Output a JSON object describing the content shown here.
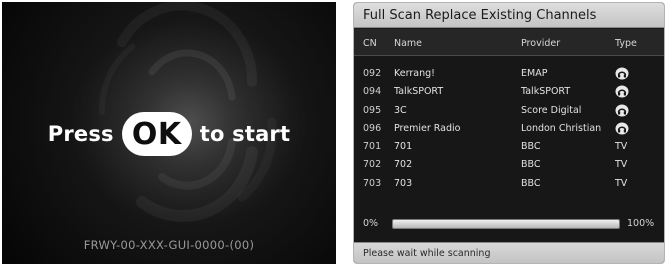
{
  "splash": {
    "press_label": "Press",
    "ok_label": "OK",
    "to_start_label": "to start",
    "firmware_code": "FRWY-00-XXX-GUI-0000-(00)"
  },
  "scan_panel": {
    "title": "Full Scan Replace Existing Channels",
    "columns": {
      "cn": "CN",
      "name": "Name",
      "provider": "Provider",
      "type": "Type"
    },
    "channels": [
      {
        "cn": "092",
        "name": "Kerrang!",
        "provider": "EMAP",
        "type": "",
        "type_icon": "radio-icon"
      },
      {
        "cn": "094",
        "name": "TalkSPORT",
        "provider": "TalkSPORT",
        "type": "",
        "type_icon": "radio-icon"
      },
      {
        "cn": "095",
        "name": "3C",
        "provider": "Score Digital",
        "type": "",
        "type_icon": "radio-icon"
      },
      {
        "cn": "096",
        "name": "Premier Radio",
        "provider": "London Christian",
        "type": "",
        "type_icon": "radio-icon"
      },
      {
        "cn": "701",
        "name": "701",
        "provider": "BBC",
        "type": "TV",
        "type_icon": ""
      },
      {
        "cn": "702",
        "name": "702",
        "provider": "BBC",
        "type": "TV",
        "type_icon": ""
      },
      {
        "cn": "703",
        "name": "703",
        "provider": "BBC",
        "type": "TV",
        "type_icon": ""
      }
    ],
    "progress": {
      "start_label": "0%",
      "end_label": "100%",
      "fraction": 1.0
    },
    "status_text": "Please wait while scanning"
  }
}
